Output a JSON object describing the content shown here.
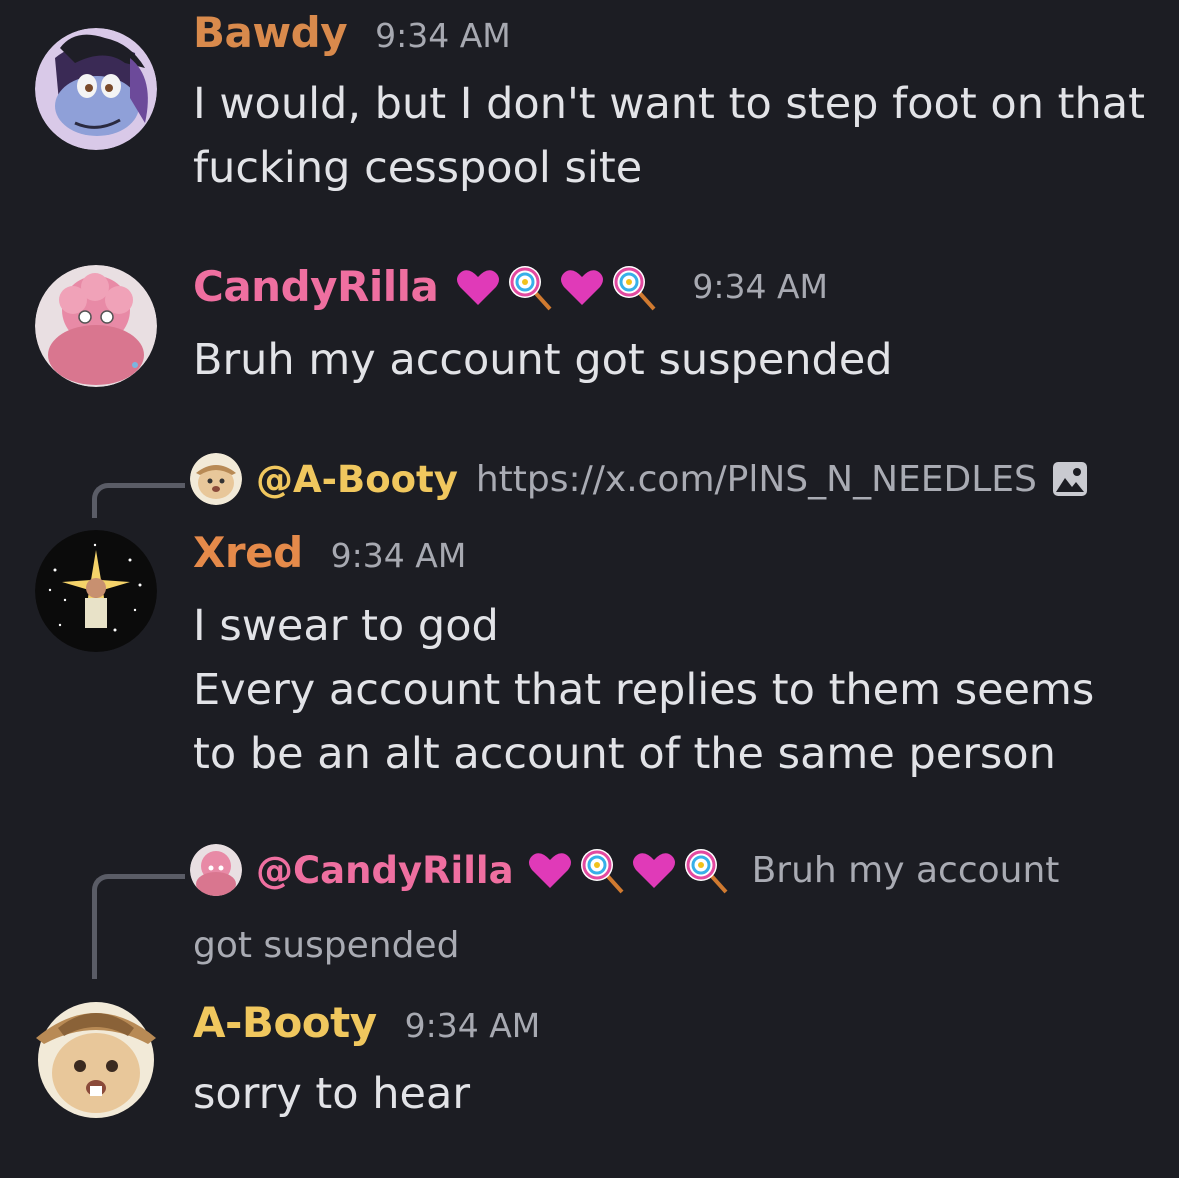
{
  "messages": [
    {
      "author": "Bawdy",
      "author_color": "#d98a4c",
      "time": "9:34 AM",
      "text": "I would, but I don't want to step foot on that fucking cesspool site"
    },
    {
      "author": "CandyRilla",
      "author_color": "#ef6fa0",
      "time": "9:34 AM",
      "text": "Bruh my account got suspended",
      "name_emojis": [
        "pink-heart",
        "lollipop",
        "pink-heart",
        "lollipop"
      ]
    },
    {
      "author": "Xred",
      "author_color": "#e58a4a",
      "time": "9:34 AM",
      "reply": {
        "mention": "@A-Booty",
        "mention_color": "#f0c75e",
        "preview": "https://x.com/PlNS_N_NEEDLES",
        "preview_icon": "image-icon"
      },
      "lines": [
        "I swear to god",
        "Every account that replies to them seems",
        "to be an alt account of the same person"
      ]
    },
    {
      "author": "A-Booty",
      "author_color": "#f0c75e",
      "time": "9:34 AM",
      "reply": {
        "mention": "@CandyRilla",
        "mention_color": "#ef6fa0",
        "preview_line1": "Bruh my account",
        "preview_line2": "got suspended"
      },
      "text": "sorry to hear"
    }
  ]
}
